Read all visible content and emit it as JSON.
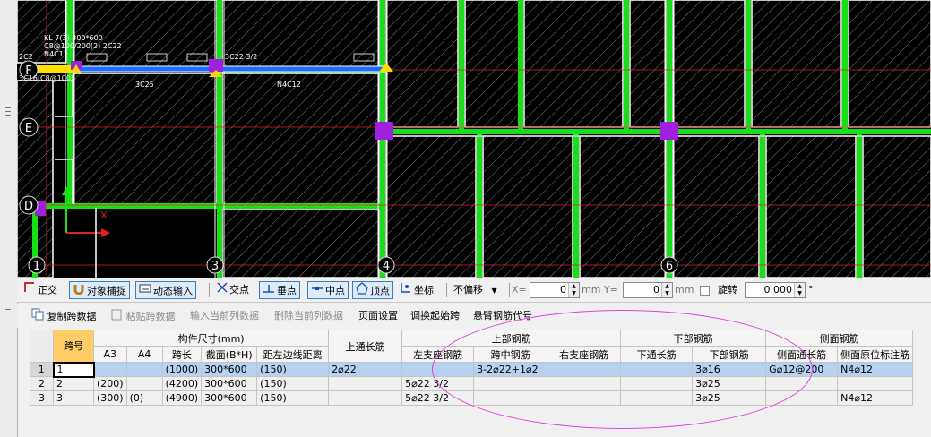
{
  "cad": {
    "axes": [
      "F",
      "E",
      "D",
      "1",
      "3",
      "4",
      "6"
    ],
    "beam_labels": [
      "KL 7(3) 300*600",
      "C8@100/200(2) 2C22",
      "N4C12",
      "2C2",
      "3C16(C8@100)",
      "3C22 3/2",
      "3C25",
      "N4C12"
    ]
  },
  "snapbar": {
    "orthogonal": "正交",
    "object_snap": "对象捕捉",
    "dynamic_input": "动态输入",
    "intersection": "交点",
    "perpendicular": "垂点",
    "midpoint": "中点",
    "vertex": "顶点",
    "coordinate": "坐标",
    "offset_mode": "不偏移",
    "x_label": "X=",
    "x_value": "0",
    "y_label": "mm  Y=",
    "y_value": "0",
    "mm": "mm",
    "rotate_label": "旋转",
    "rotate_value": "0.000",
    "degree": "°"
  },
  "toolbar": {
    "copy_span": "复制跨数据",
    "paste_span": "粘贴跨数据",
    "input_column": "输入当前列数据",
    "delete_column": "删除当前列数据",
    "page_setup": "页面设置",
    "adjust_start": "调换起始跨",
    "cantilever_code": "悬臂钢筋代号"
  },
  "table": {
    "headers": {
      "span": "跨号",
      "dims": "构件尺寸(mm)",
      "a3": "A3",
      "a4": "A4",
      "span_len": "跨长",
      "section": "截面(B*H)",
      "offset": "距左边线距离",
      "top_through": "上通长筋",
      "top_steel": "上部钢筋",
      "left_support": "左支座钢筋",
      "mid_span": "跨中钢筋",
      "right_support": "右支座钢筋",
      "bottom_steel": "下部钢筋",
      "bottom_through": "下通长筋",
      "bottom_bars": "下部钢筋",
      "side_steel": "侧面钢筋",
      "side_through": "侧面通长筋",
      "side_original": "侧面原位标注筋"
    },
    "rows": [
      {
        "no": "1",
        "span": "1",
        "a3": "",
        "a4": "",
        "len": "(1000)",
        "section": "300*600",
        "offset": "(150)",
        "top_through": "2⌀22",
        "left": "",
        "mid": "3-2⌀22+1⌀2",
        "right": "",
        "bot_through": "",
        "bottom": "3⌀16",
        "side_through": "G⌀12@200",
        "side_orig": "N4⌀12"
      },
      {
        "no": "2",
        "span": "2",
        "a3": "(200)",
        "a4": "",
        "len": "(4200)",
        "section": "300*600",
        "offset": "(150)",
        "top_through": "",
        "left": "5⌀22 3/2",
        "mid": "",
        "right": "",
        "bot_through": "",
        "bottom": "3⌀25",
        "side_through": "",
        "side_orig": ""
      },
      {
        "no": "3",
        "span": "3",
        "a3": "(300)",
        "a4": "(0)",
        "len": "(4900)",
        "section": "300*600",
        "offset": "(150)",
        "top_through": "",
        "left": "5⌀22 3/2",
        "mid": "",
        "right": "",
        "bot_through": "",
        "bottom": "3⌀25",
        "side_through": "",
        "side_orig": "N4⌀12"
      }
    ]
  }
}
